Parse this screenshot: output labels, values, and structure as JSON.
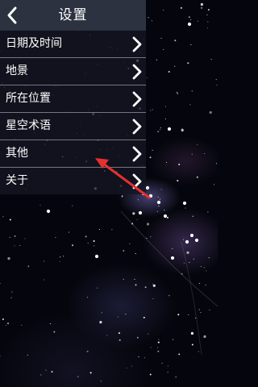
{
  "header": {
    "title": "设置",
    "back_icon": "chevron-left-icon"
  },
  "menu": {
    "items": [
      {
        "label": "日期及时间",
        "icon": "chevron-right-icon"
      },
      {
        "label": "地景",
        "icon": "chevron-right-icon"
      },
      {
        "label": "所在位置",
        "icon": "chevron-right-icon"
      },
      {
        "label": "星空术语",
        "icon": "chevron-right-icon"
      },
      {
        "label": "其他",
        "icon": "chevron-right-icon"
      },
      {
        "label": "关于",
        "icon": "chevron-right-icon"
      }
    ]
  },
  "annotation": {
    "color": "#e53030",
    "target": "其他"
  },
  "colors": {
    "titlebar": "#2d3240",
    "panel": "#141622",
    "text": "#ffffff",
    "background": "#05060d"
  }
}
